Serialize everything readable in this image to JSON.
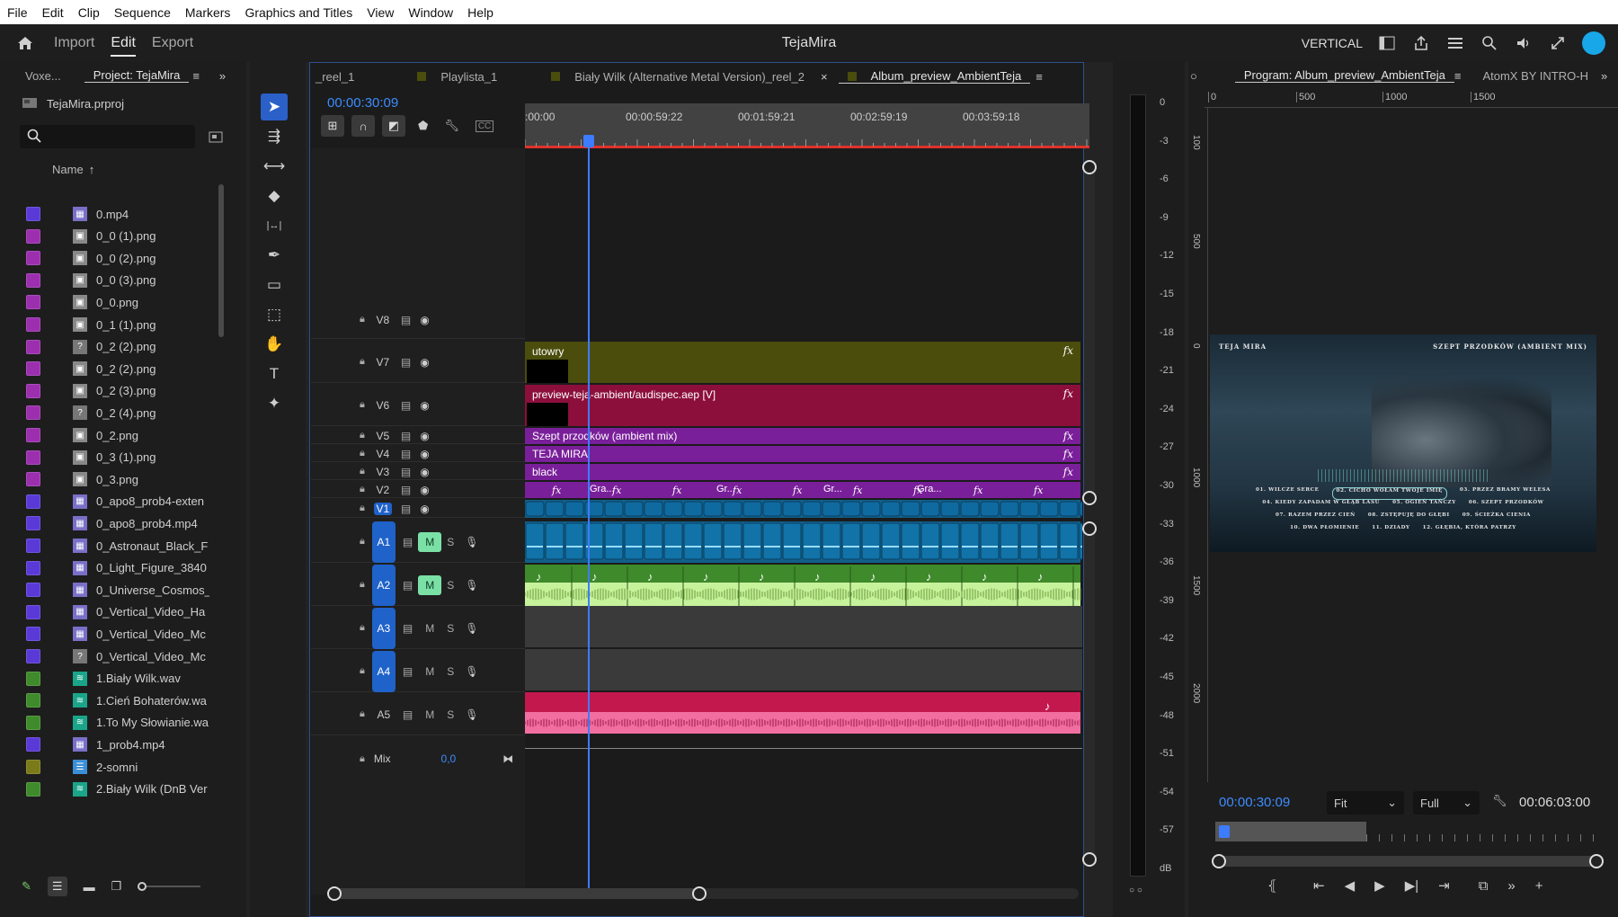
{
  "menu": [
    "File",
    "Edit",
    "Clip",
    "Sequence",
    "Markers",
    "Graphics and Titles",
    "View",
    "Window",
    "Help"
  ],
  "topbar": {
    "tabs": [
      "Import",
      "Edit",
      "Export"
    ],
    "active_tab": "Edit",
    "title": "TejaMira",
    "right_label": "VERTICAL"
  },
  "project_panel": {
    "tabs": [
      "Voxe...",
      "Project: TejaMira"
    ],
    "project_file": "TejaMira.prproj",
    "search_placeholder": "",
    "column_header": "Name",
    "items": [
      {
        "name": "0.mp4",
        "label_color": "#5a3ad6",
        "icon": "video-icon"
      },
      {
        "name": "0_0 (1).png",
        "label_color": "#9b2fae",
        "icon": "image-icon"
      },
      {
        "name": "0_0 (2).png",
        "label_color": "#9b2fae",
        "icon": "image-icon"
      },
      {
        "name": "0_0 (3).png",
        "label_color": "#9b2fae",
        "icon": "image-icon"
      },
      {
        "name": "0_0.png",
        "label_color": "#9b2fae",
        "icon": "image-icon"
      },
      {
        "name": "0_1 (1).png",
        "label_color": "#9b2fae",
        "icon": "image-icon"
      },
      {
        "name": "0_2 (2).png",
        "label_color": "#9b2fae",
        "icon": "missing-icon"
      },
      {
        "name": "0_2 (2).png",
        "label_color": "#9b2fae",
        "icon": "image-icon"
      },
      {
        "name": "0_2 (3).png",
        "label_color": "#9b2fae",
        "icon": "image-icon"
      },
      {
        "name": "0_2 (4).png",
        "label_color": "#9b2fae",
        "icon": "missing-icon"
      },
      {
        "name": "0_2.png",
        "label_color": "#9b2fae",
        "icon": "image-icon"
      },
      {
        "name": "0_3 (1).png",
        "label_color": "#9b2fae",
        "icon": "image-icon"
      },
      {
        "name": "0_3.png",
        "label_color": "#9b2fae",
        "icon": "image-icon"
      },
      {
        "name": "0_apo8_prob4-exten",
        "label_color": "#5a3ad6",
        "icon": "video-icon"
      },
      {
        "name": "0_apo8_prob4.mp4",
        "label_color": "#5a3ad6",
        "icon": "video-icon"
      },
      {
        "name": "0_Astronaut_Black_F",
        "label_color": "#5a3ad6",
        "icon": "video-icon"
      },
      {
        "name": "0_Light_Figure_3840",
        "label_color": "#5a3ad6",
        "icon": "video-icon"
      },
      {
        "name": "0_Universe_Cosmos_",
        "label_color": "#5a3ad6",
        "icon": "video-icon"
      },
      {
        "name": "0_Vertical_Video_Ha",
        "label_color": "#5a3ad6",
        "icon": "video-icon"
      },
      {
        "name": "0_Vertical_Video_Mc",
        "label_color": "#5a3ad6",
        "icon": "video-icon"
      },
      {
        "name": "0_Vertical_Video_Mc",
        "label_color": "#5a3ad6",
        "icon": "missing-icon"
      },
      {
        "name": "1.Biały Wilk.wav",
        "label_color": "#3f8a2a",
        "icon": "audio-icon"
      },
      {
        "name": "1.Cień Bohaterów.wa",
        "label_color": "#3f8a2a",
        "icon": "audio-icon"
      },
      {
        "name": "1.To My Słowianie.wa",
        "label_color": "#3f8a2a",
        "icon": "audio-icon"
      },
      {
        "name": "1_prob4.mp4",
        "label_color": "#5a3ad6",
        "icon": "video-icon"
      },
      {
        "name": "2-somni",
        "label_color": "#7a7a18",
        "icon": "sequence-icon"
      },
      {
        "name": "2.Biały Wilk (DnB Ver",
        "label_color": "#3f8a2a",
        "icon": "audio-icon"
      }
    ]
  },
  "timeline": {
    "tabs": [
      "_reel_1",
      "Playlista_1",
      "Biały Wilk (Alternative Metal Version)_reel_2",
      "Album_preview_AmbientTeja"
    ],
    "timecode": "00:00:30:09",
    "ruler_labels": [
      ":00:00",
      "00:00:59:22",
      "00:01:59:21",
      "00:02:59:19",
      "00:03:59:18"
    ],
    "playhead_fraction": 0.113,
    "video_tracks": [
      {
        "name": "V8"
      },
      {
        "name": "V7"
      },
      {
        "name": "V6"
      },
      {
        "name": "V5"
      },
      {
        "name": "V4"
      },
      {
        "name": "V3"
      },
      {
        "name": "V2"
      },
      {
        "name": "V1"
      }
    ],
    "audio_tracks": [
      {
        "name": "A1",
        "mute_label": "M",
        "solo_label": "S"
      },
      {
        "name": "A2",
        "mute_label": "M",
        "solo_label": "S"
      },
      {
        "name": "A3",
        "mute_label": "M",
        "solo_label": "S"
      },
      {
        "name": "A4",
        "mute_label": "M",
        "solo_label": "S"
      },
      {
        "name": "A5",
        "mute_label": "M",
        "solo_label": "S"
      }
    ],
    "mix_label": "Mix",
    "mix_value": "0,0",
    "clips": {
      "v7": "utowry",
      "v6": "preview-teja-ambient/audispec.aep [V]",
      "v5": "Szept przodków (ambient mix)",
      "v4": "TEJA MIRA",
      "v3": "black",
      "v2_labels": [
        "Gra...",
        "Gr...",
        "Gr...",
        "Gra..."
      ]
    },
    "clip_colors": {
      "v7": "#4a4d0c",
      "v6": "#8c0f3b",
      "purple": "#7a1f9a",
      "v1": "#11608a",
      "a2": "#3f8a2a",
      "a5": "#c2184e"
    },
    "fx_label": "fx"
  },
  "meter": {
    "labels": [
      "0",
      "-3",
      "-6",
      "-9",
      "-12",
      "-15",
      "-18",
      "-21",
      "-24",
      "-27",
      "-30",
      "-33",
      "-36",
      "-39",
      "-42",
      "-45",
      "-48",
      "-51",
      "-54",
      "-57",
      "dB"
    ]
  },
  "program_monitor": {
    "tabs": [
      "Program: Album_preview_AmbientTeja",
      "AtomX BY INTRO-H"
    ],
    "ruler_labels": [
      "0",
      "500",
      "1000",
      "1500"
    ],
    "side_ruler_labels": [
      "0",
      "100",
      "500",
      "1000",
      "1500",
      "2000"
    ],
    "timecode": "00:00:30:09",
    "fit": "Fit",
    "quality": "Full",
    "duration": "00:06:03:00",
    "frame": {
      "artist": "TEJA MIRA",
      "album": "SZEPT PRZODKÓW (AMBIENT MIX)",
      "tracklist": [
        "01. WILCZE SERCE",
        "02. CICHO WOŁAM TWOJE IMIĘ",
        "03. PRZEZ BRAMY WELESA",
        "04. KIEDY ZAPADAM W GŁĄB LASU",
        "05. OGIEŃ TAŃCZY",
        "06. SZEPT PRZODKÓW",
        "07. RAZEM PRZEZ CIEŃ",
        "08. ZSTĘPUJĘ DO GŁĘBI",
        "09. ŚCIEŻKA CIENIA",
        "10. DWA PŁOMIENIE",
        "11. DZIADY",
        "12. GŁĘBIA, KTÓRA PATRZY"
      ]
    }
  }
}
